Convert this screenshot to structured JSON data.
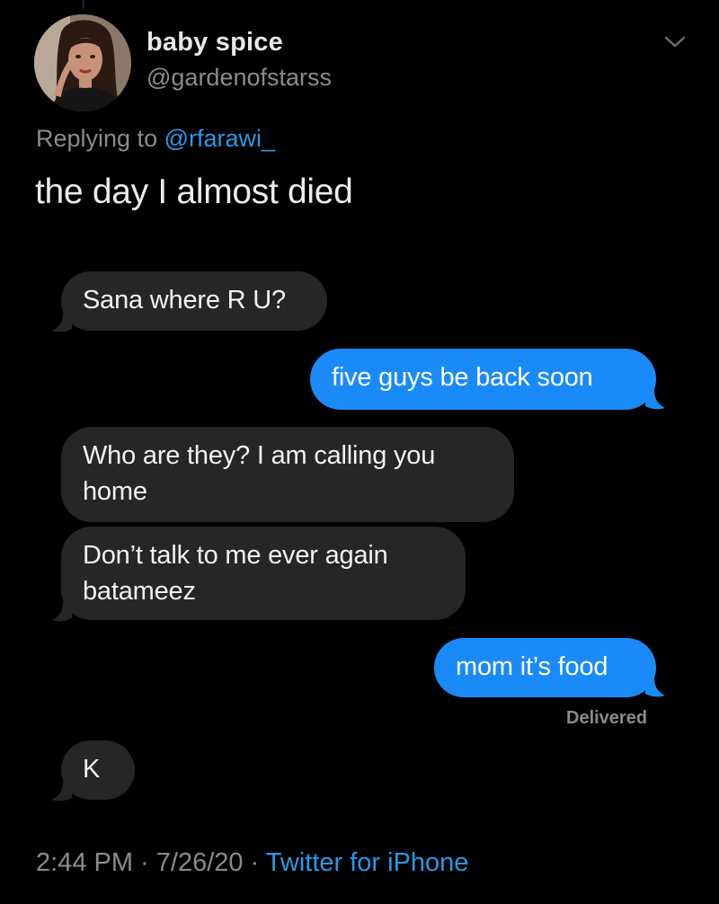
{
  "author": {
    "display_name": "baby spice",
    "handle": "@gardenofstarss"
  },
  "reply": {
    "prefix": "Replying to",
    "mention": "@rfarawi_"
  },
  "tweet": {
    "text": "the day I almost died"
  },
  "messages": [
    {
      "direction": "incoming",
      "text": "Sana where R U?"
    },
    {
      "direction": "outgoing",
      "text": "five guys be back soon"
    },
    {
      "direction": "incoming",
      "text": "Who are they? I am calling you home"
    },
    {
      "direction": "incoming",
      "text": "Don’t talk to me ever again batameez"
    },
    {
      "direction": "outgoing",
      "text": "mom it’s food"
    },
    {
      "direction": "incoming",
      "text": "K"
    }
  ],
  "delivered_label": "Delivered",
  "footer": {
    "timestamp": "2:44 PM · 7/26/20 · ",
    "source": "Twitter for iPhone"
  },
  "colors": {
    "background": "#000000",
    "incoming_bubble": "#262629",
    "outgoing_bubble": "#1a8af9",
    "link": "#2a98e6",
    "muted": "#8b8b8b"
  },
  "icons": {
    "avatar": "profile-photo",
    "menu": "chevron-down-icon"
  }
}
